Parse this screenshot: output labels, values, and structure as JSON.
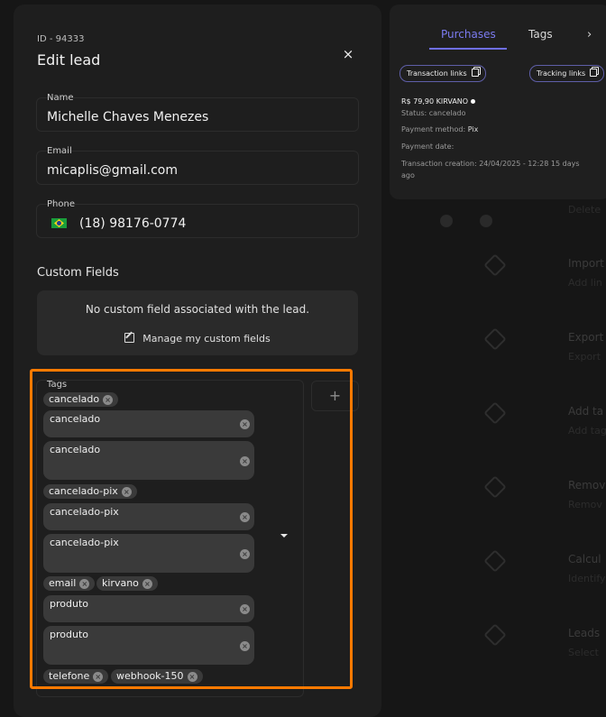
{
  "background": {
    "rows": [
      {
        "title": "",
        "subtitle": "Delete"
      },
      {
        "title": "Import",
        "subtitle": "Add lin"
      },
      {
        "title": "Export",
        "subtitle": "Export"
      },
      {
        "title": "Add ta",
        "subtitle": "Add tag"
      },
      {
        "title": "Remov",
        "subtitle": "Remov"
      },
      {
        "title": "Calcul",
        "subtitle": "Identify"
      },
      {
        "title": "Leads",
        "subtitle": "Select"
      }
    ]
  },
  "modal": {
    "id_label": "ID - 94333",
    "title": "Edit lead",
    "close_icon": "×",
    "fields": {
      "name": {
        "label": "Name",
        "value": "Michelle Chaves Menezes"
      },
      "email": {
        "label": "Email",
        "value": "micaplis@gmail.com"
      },
      "phone": {
        "label": "Phone",
        "value": "(18) 98176-0774",
        "country_flag": "brazil-flag"
      }
    },
    "custom_fields": {
      "title": "Custom Fields",
      "empty_text": "No custom field associated with the lead.",
      "manage_link": "Manage my custom fields"
    },
    "tags": {
      "label": "Tags",
      "chips": [
        "cancelado",
        "cancelado-pix",
        "email",
        "kirvano",
        "telefone",
        "webhook-150"
      ],
      "expanded_options": [
        "cancelado",
        "cancelado",
        "cancelado-pix",
        "cancelado-pix",
        "produto",
        "produto"
      ],
      "add_button": "+"
    }
  },
  "purchases": {
    "tabs": {
      "active": "Purchases",
      "second": "Tags",
      "next": "›"
    },
    "buttons": {
      "transaction_links": "Transaction links",
      "tracking_links": "Tracking links"
    },
    "header": "R$ 79,90  KIRVANO",
    "status": "Status: cancelado",
    "payment_method_label": "Payment method:",
    "payment_method_value": "Pix",
    "payment_date": "Payment date:",
    "transaction_creation_1": "Transaction creation: 24/04/2025 - 12:28 15 days",
    "transaction_creation_2": "ago"
  },
  "colors": {
    "accent": "#6f6ff0",
    "highlight": "#ff7a00",
    "modal_bg": "#1e1e1e"
  }
}
